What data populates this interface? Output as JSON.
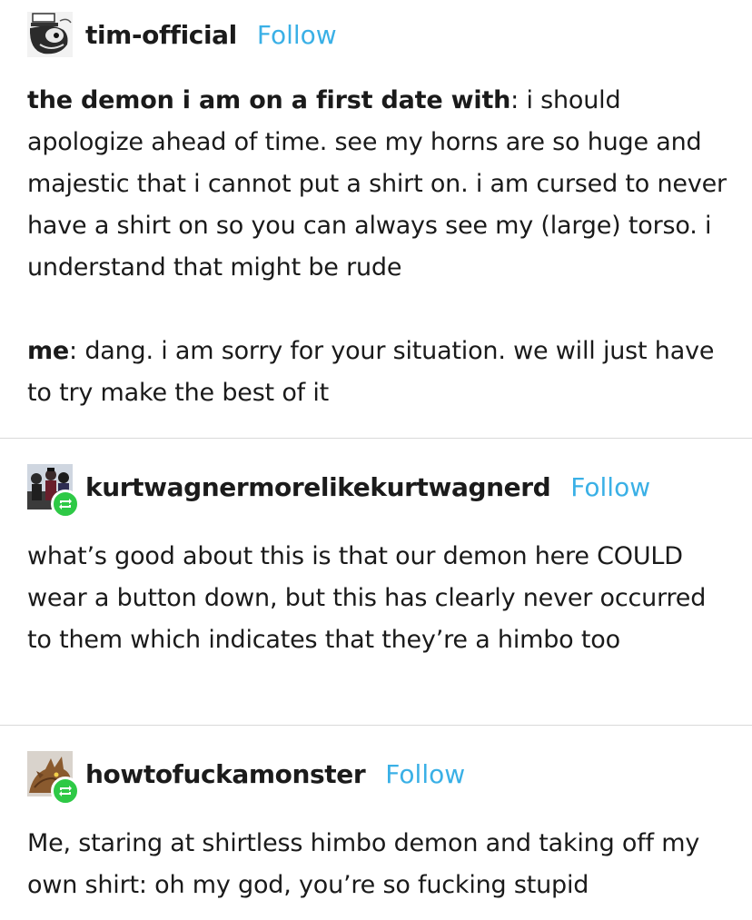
{
  "posts": [
    {
      "username": "tim-official",
      "follow_label": "Follow",
      "avatar_icon": "sketched-face-avatar",
      "reblogged": false,
      "lines": [
        {
          "speaker": "the demon i am on a first date with",
          "text": ": i should apologize ahead of time. see my horns are so huge and majestic that i cannot put a shirt on. i am cursed to never have a shirt on so you can always see my (large) torso. i understand that might be rude"
        },
        {
          "speaker": "me",
          "text": ": dang. i am sorry for your situation. we will just have to try make the best of it"
        }
      ]
    },
    {
      "username": "kurtwagnermorelikekurtwagnerd",
      "follow_label": "Follow",
      "avatar_icon": "group-photo-avatar",
      "reblogged": true,
      "reblog_icon": "reblog-icon",
      "text": "what’s good about this is that our demon here COULD wear a button down, but this has clearly never occurred to them which indicates that they’re a himbo too"
    },
    {
      "username": "howtofuckamonster",
      "follow_label": "Follow",
      "avatar_icon": "dragon-head-avatar",
      "reblogged": true,
      "reblog_icon": "reblog-icon",
      "text": "Me, staring at shirtless himbo demon and taking off my own shirt: oh my god, you’re so fucking stupid"
    }
  ],
  "colors": {
    "follow": "#3ab0e6",
    "reblog_badge": "#2ec946",
    "divider": "#d9d9d9",
    "text": "#1a1a1a"
  }
}
